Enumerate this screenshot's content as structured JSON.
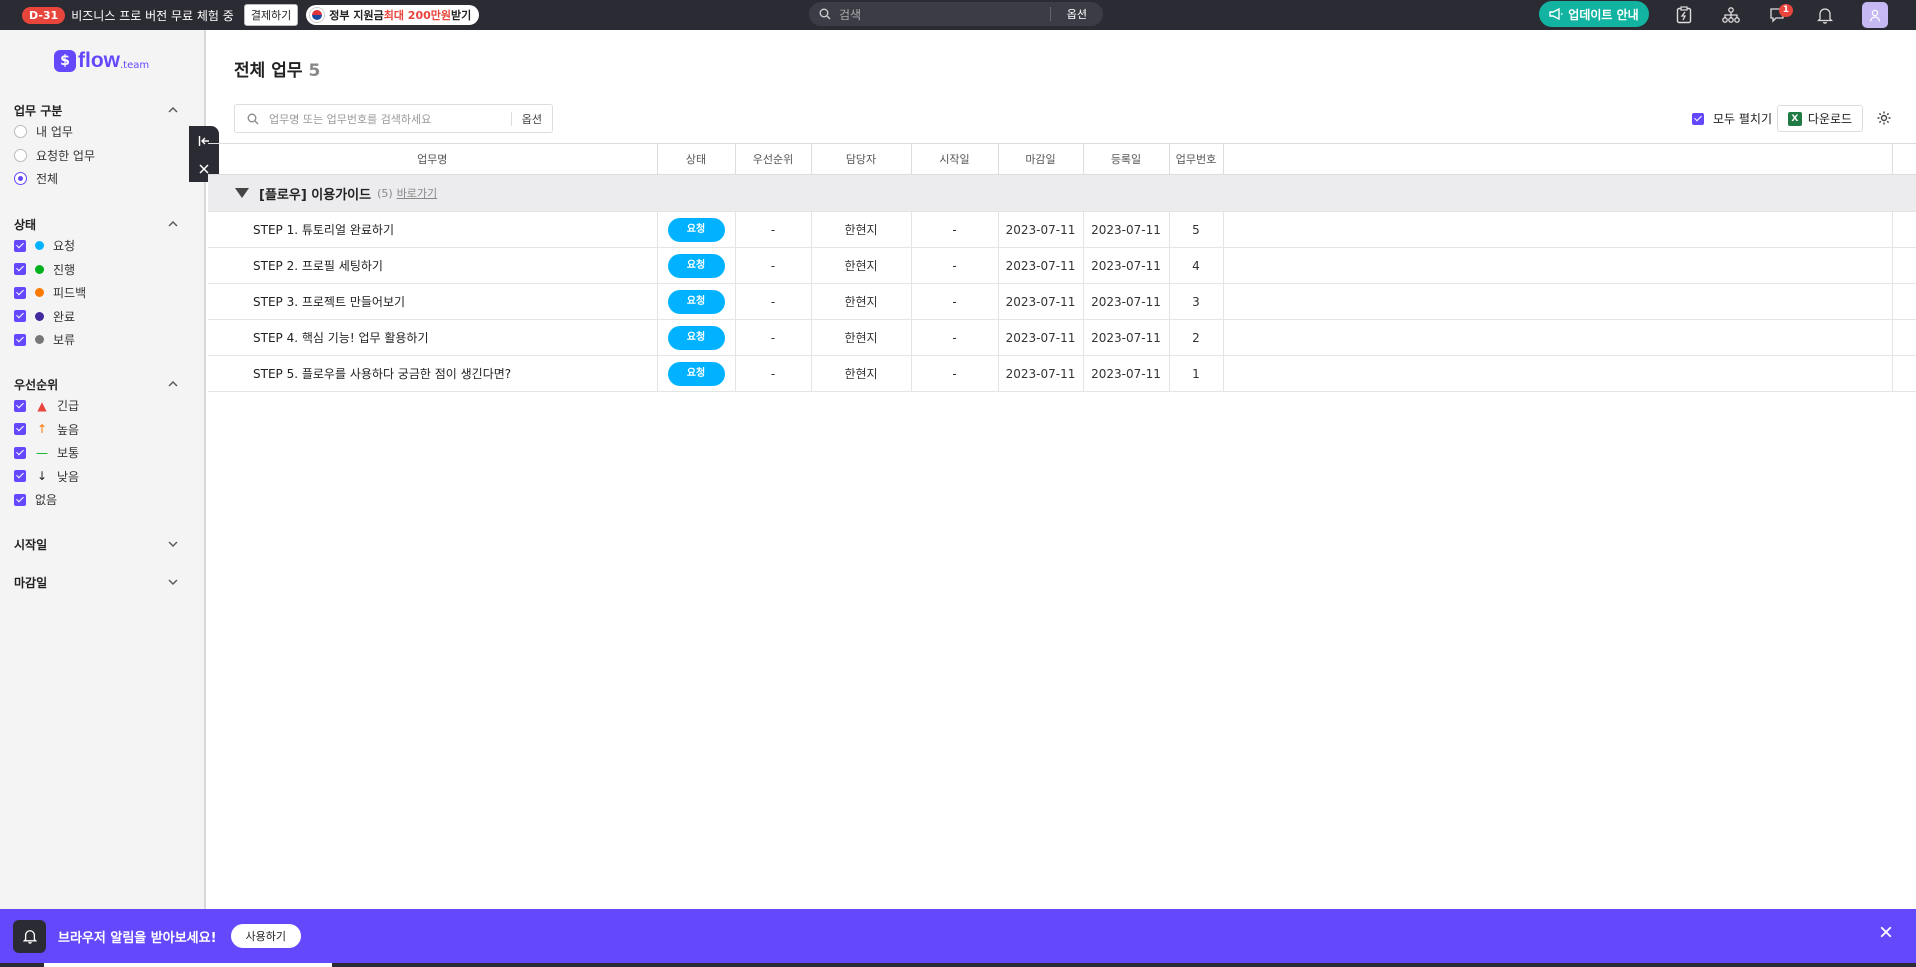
{
  "topbar": {
    "dday_badge": "D-31",
    "trial_text": "비즈니스 프로 버전 무료 체험 중",
    "pay_button": "결제하기",
    "gov_text_pre": "정부 지원금 ",
    "gov_text_highlight": "최대 200만원",
    "gov_text_post": " 받기",
    "search_placeholder": "검색",
    "search_option": "옵션",
    "update_button": "업데이트 안내",
    "notification_count": "1",
    "icons": [
      "lightning-clipboard-icon",
      "org-chart-icon",
      "chat-icon",
      "bell-icon",
      "user-avatar-icon"
    ]
  },
  "sidebar": {
    "logo_text": "flow",
    "logo_sub": ".team",
    "task_type": {
      "title": "업무 구분",
      "options": [
        "내 업무",
        "요청한 업무",
        "전체"
      ],
      "selected": "전체"
    },
    "status": {
      "title": "상태",
      "items": [
        {
          "label": "요청",
          "color": "#00b2ff"
        },
        {
          "label": "진행",
          "color": "#00b01c"
        },
        {
          "label": "피드백",
          "color": "#fd7900"
        },
        {
          "label": "완료",
          "color": "#402a9d"
        },
        {
          "label": "보류",
          "color": "#777777"
        }
      ]
    },
    "priority": {
      "title": "우선순위",
      "items": [
        {
          "label": "긴급",
          "icon": "siren-icon",
          "glyph": "🚨",
          "color": "#e8453c"
        },
        {
          "label": "높음",
          "icon": "arrow-up-icon",
          "glyph": "↑",
          "color": "#fd7900"
        },
        {
          "label": "보통",
          "icon": "dash-icon",
          "glyph": "—",
          "color": "#00b01c"
        },
        {
          "label": "낮음",
          "icon": "arrow-down-icon",
          "glyph": "↓",
          "color": "#222222"
        },
        {
          "label": "없음",
          "icon": "",
          "glyph": "",
          "color": ""
        }
      ]
    },
    "start_date_title": "시작일",
    "due_date_title": "마감일"
  },
  "main": {
    "title": "전체 업무",
    "count": "5",
    "search_placeholder": "업무명 또는 업무번호를 검색하세요",
    "search_option": "옵션",
    "expand_all": "모두 펼치기",
    "download": "다운로드",
    "columns": [
      "업무명",
      "상태",
      "우선순위",
      "담당자",
      "시작일",
      "마감일",
      "등록일",
      "업무번호"
    ],
    "group": {
      "name": "[플로우] 이용가이드",
      "count": "(5)",
      "link": "바로가기"
    },
    "rows": [
      {
        "name": "STEP 1. 튜토리얼 완료하기",
        "status": "요청",
        "priority": "-",
        "assignee": "한현지",
        "start": "-",
        "due": "2023-07-11",
        "created": "2023-07-11",
        "id": "5"
      },
      {
        "name": "STEP 2. 프로필 세팅하기",
        "status": "요청",
        "priority": "-",
        "assignee": "한현지",
        "start": "-",
        "due": "2023-07-11",
        "created": "2023-07-11",
        "id": "4"
      },
      {
        "name": "STEP 3. 프로젝트 만들어보기",
        "status": "요청",
        "priority": "-",
        "assignee": "한현지",
        "start": "-",
        "due": "2023-07-11",
        "created": "2023-07-11",
        "id": "3"
      },
      {
        "name": "STEP 4. 핵심 기능! 업무 활용하기",
        "status": "요청",
        "priority": "-",
        "assignee": "한현지",
        "start": "-",
        "due": "2023-07-11",
        "created": "2023-07-11",
        "id": "2"
      },
      {
        "name": "STEP 5. 플로우를 사용하다 궁금한 점이 생긴다면?",
        "status": "요청",
        "priority": "-",
        "assignee": "한현지",
        "start": "-",
        "due": "2023-07-11",
        "created": "2023-07-11",
        "id": "1"
      }
    ]
  },
  "bottom_bar": {
    "message": "브라우저 알림을 받아보세요!",
    "use_button": "사용하기"
  },
  "colors": {
    "brand": "#6449fc",
    "status_request": "#00b2ff",
    "overdue": "#e8453c",
    "topbar": "#2b2b33"
  }
}
